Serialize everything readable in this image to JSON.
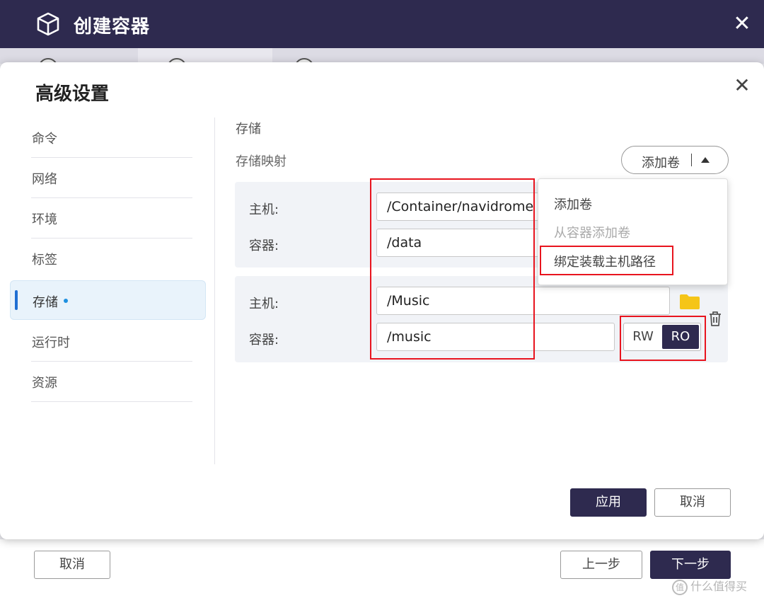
{
  "window": {
    "title": "创建容器",
    "close_icon": "close-icon",
    "icon": "cube-icon"
  },
  "footer": {
    "cancel_label": "取消",
    "prev_label": "上一步",
    "next_label": "下一步"
  },
  "dialog": {
    "title": "高级设置",
    "close_icon": "close-icon",
    "nav": [
      {
        "label": "命令",
        "active": false
      },
      {
        "label": "网络",
        "active": false
      },
      {
        "label": "环境",
        "active": false
      },
      {
        "label": "标签",
        "active": false
      },
      {
        "label": "存储",
        "active": true
      },
      {
        "label": "运行时",
        "active": false
      },
      {
        "label": "资源",
        "active": false
      }
    ],
    "section_title": "存储",
    "section_subtitle": "存储映射",
    "add_volume_label": "添加卷",
    "dropdown": {
      "items": [
        {
          "label": "添加卷",
          "disabled": false
        },
        {
          "label": "从容器添加卷",
          "disabled": true
        },
        {
          "label": "绑定装载主机路径",
          "disabled": false
        }
      ]
    },
    "mappings": [
      {
        "host_label": "主机:",
        "host_value": "/Container/navidrome",
        "container_label": "容器:",
        "container_value": "/data"
      },
      {
        "host_label": "主机:",
        "host_value": "/Music",
        "container_label": "容器:",
        "container_value": "/music",
        "mode_rw": "RW",
        "mode_ro": "RO",
        "mode_selected": "RO"
      }
    ],
    "apply_label": "应用",
    "cancel_label": "取消"
  },
  "watermark": {
    "text": "什么值得买",
    "logo": "值"
  },
  "colors": {
    "header": "#2e2a4f",
    "accent": "#1f6fd3",
    "highlight": "#e8141e",
    "folder": "#f5c518"
  }
}
